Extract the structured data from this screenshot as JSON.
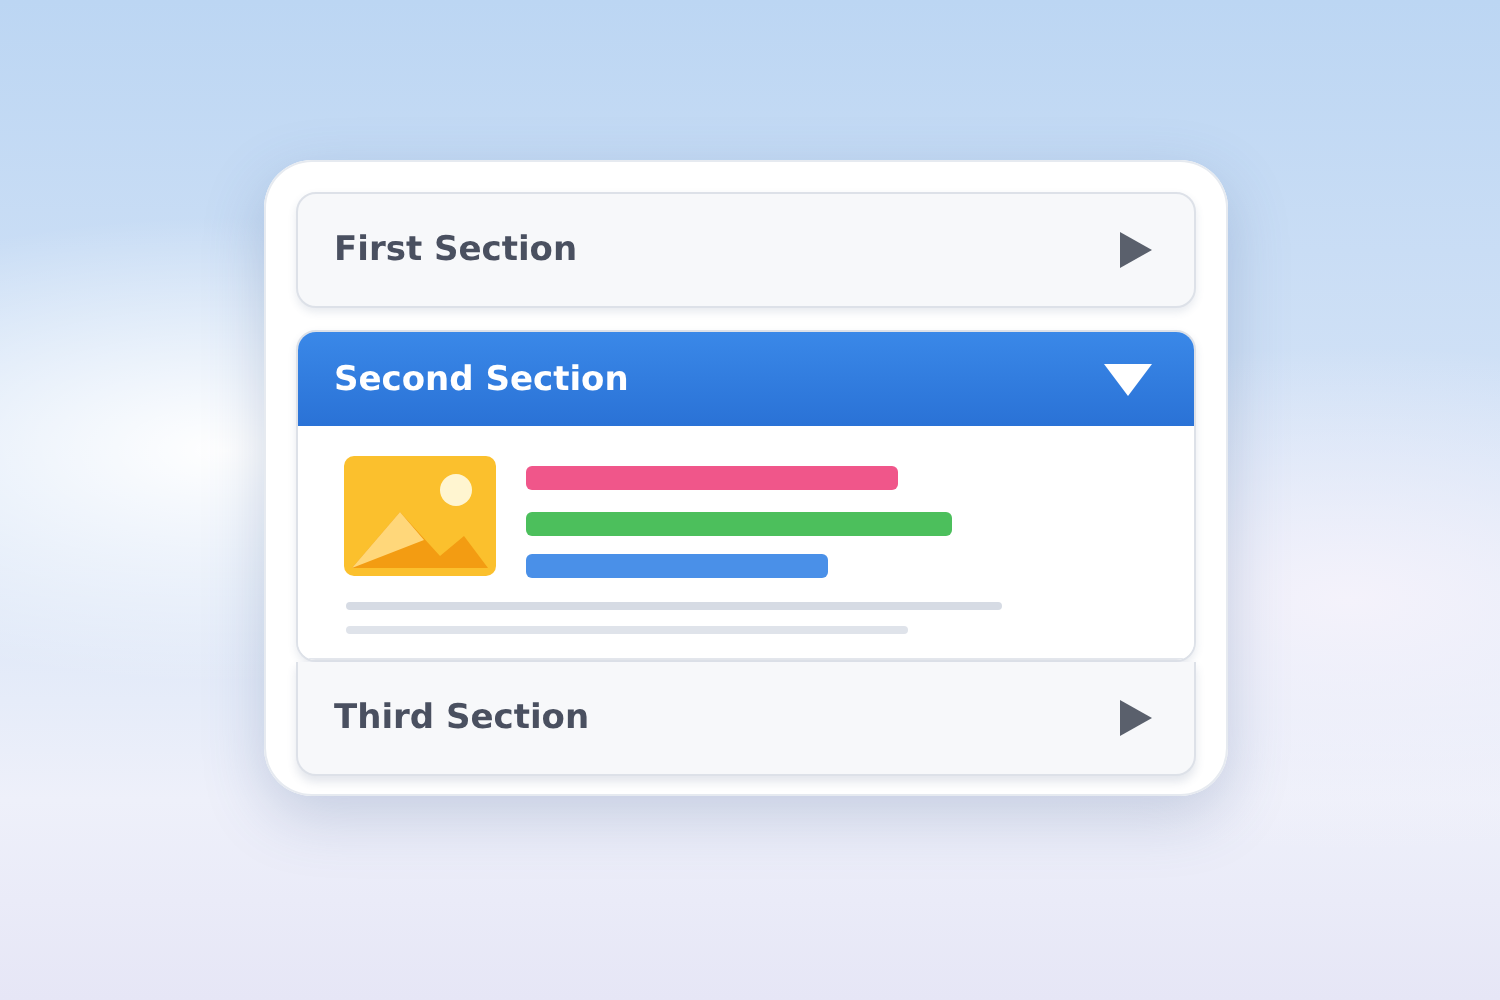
{
  "sections": [
    {
      "title": "First Section",
      "expanded": false
    },
    {
      "title": "Second Section",
      "expanded": true
    },
    {
      "title": "Third Section",
      "expanded": false
    }
  ]
}
